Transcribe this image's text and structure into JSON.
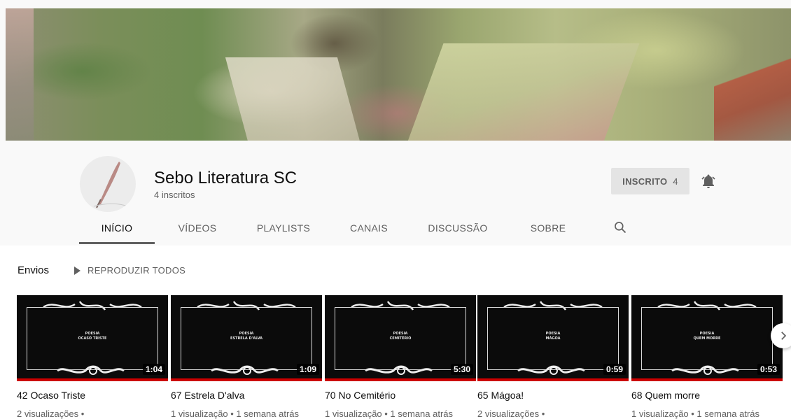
{
  "channel": {
    "name": "Sebo Literatura SC",
    "subscribers": "4 inscritos",
    "subscribe_label": "INSCRITO",
    "subscribe_count": "4"
  },
  "tabs": [
    {
      "label": "INÍCIO",
      "active": true
    },
    {
      "label": "VÍDEOS",
      "active": false
    },
    {
      "label": "PLAYLISTS",
      "active": false
    },
    {
      "label": "CANAIS",
      "active": false
    },
    {
      "label": "DISCUSSÃO",
      "active": false
    },
    {
      "label": "SOBRE",
      "active": false
    }
  ],
  "uploads": {
    "title": "Envios",
    "play_all": "REPRODUZIR TODOS",
    "videos": [
      {
        "title": "42 Ocaso Triste",
        "meta": "2 visualizações •",
        "duration": "1:04",
        "thumb_line1": "POESIA",
        "thumb_line2": "OCASO TRISTE"
      },
      {
        "title": "67 Estrela D'alva",
        "meta": "1 visualização • 1 semana atrás",
        "duration": "1:09",
        "thumb_line1": "POESIA",
        "thumb_line2": "ESTRELA D'ALVA"
      },
      {
        "title": "70 No Cemitério",
        "meta": "1 visualização • 1 semana atrás",
        "duration": "5:30",
        "thumb_line1": "POESIA",
        "thumb_line2": "CEMITÉRIO"
      },
      {
        "title": "65 Mágoa!",
        "meta": "2 visualizações •",
        "duration": "0:59",
        "thumb_line1": "POESIA",
        "thumb_line2": "MÁGOA"
      },
      {
        "title": "68 Quem morre",
        "meta": "1 visualização • 1 semana atrás",
        "duration": "0:53",
        "thumb_line1": "POESIA",
        "thumb_line2": "QUEM MORRE"
      }
    ]
  },
  "icons": {
    "bell": "bell-icon",
    "search": "search-icon",
    "next": "chevron-right-icon"
  },
  "colors": {
    "progress_bar": "#cc0000",
    "subscribe_bg": "#e4e4e4"
  }
}
